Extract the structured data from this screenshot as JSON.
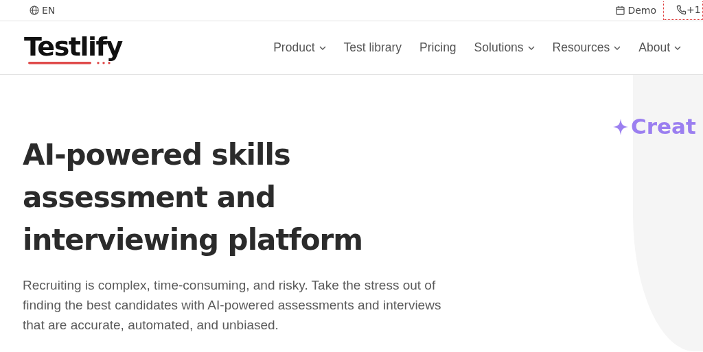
{
  "top_bar": {
    "language": "EN",
    "demo_link": "Demo",
    "phone": "+1"
  },
  "header": {
    "logo": "Testlify",
    "nav": [
      {
        "label": "Product",
        "has_menu": true
      },
      {
        "label": "Test library",
        "has_menu": false
      },
      {
        "label": "Pricing",
        "has_menu": false
      },
      {
        "label": "Solutions",
        "has_menu": true
      },
      {
        "label": "Resources",
        "has_menu": true
      },
      {
        "label": "About",
        "has_menu": true
      }
    ]
  },
  "hero": {
    "title_lines": [
      "AI-powered skills",
      "assessment and",
      "interviewing platform"
    ],
    "description": "Recruiting is complex, time-consuming, and risky. Take the stress out of finding the best candidates with AI-powered assessments and interviews that are accurate, automated, and unbiased.",
    "side_heading": "Creat"
  }
}
